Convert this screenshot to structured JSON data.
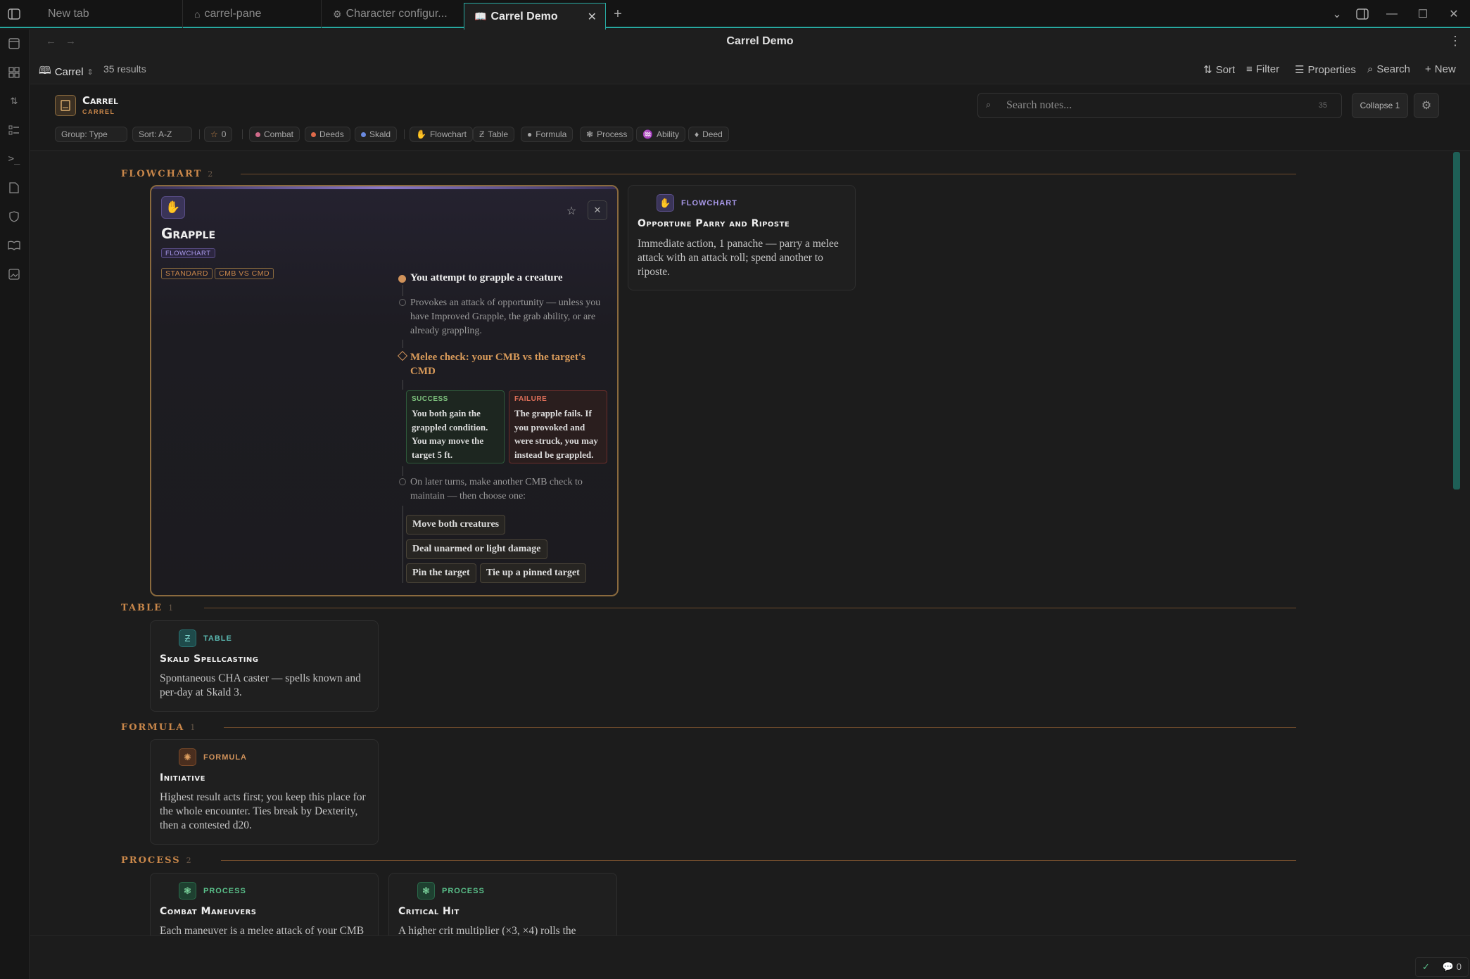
{
  "tabs": [
    {
      "label": "New tab"
    },
    {
      "label": "carrel-pane"
    },
    {
      "label": "Character configur..."
    },
    {
      "label": "Carrel Demo"
    }
  ],
  "header": {
    "title": "Carrel Demo"
  },
  "viewbar": {
    "view_name": "Carrel",
    "results": "35 results",
    "sort": "Sort",
    "filter": "Filter",
    "properties": "Properties",
    "search": "Search",
    "new": "New"
  },
  "carrel": {
    "title": "Carrel",
    "subtitle": "CARREL",
    "search_placeholder": "Search notes...",
    "search_count": "35",
    "collapse": "Collapse 1",
    "chips": [
      {
        "label": "Group: Type"
      },
      {
        "label": "Sort: A-Z"
      },
      {
        "label": "0"
      },
      {
        "label": "Combat",
        "color": "#d06a8a"
      },
      {
        "label": "Deeds",
        "color": "#e06a4a"
      },
      {
        "label": "Skald",
        "color": "#6a8ae0"
      },
      {
        "label": "Flowchart"
      },
      {
        "label": "Table"
      },
      {
        "label": "Formula"
      },
      {
        "label": "Process"
      },
      {
        "label": "Ability"
      },
      {
        "label": "Deed"
      }
    ]
  },
  "sections": {
    "flowchart": {
      "label": "FLOWCHART",
      "count": "2"
    },
    "table": {
      "label": "TABLE",
      "count": "1"
    },
    "formula": {
      "label": "FORMULA",
      "count": "1"
    },
    "process": {
      "label": "PROCESS",
      "count": "2"
    }
  },
  "grapple": {
    "title": "Grapple",
    "kind": "FLOWCHART",
    "tags": [
      "STANDARD",
      "CMB VS CMD"
    ],
    "step1": "You attempt to grapple a creature",
    "step2": "Provokes an attack of opportunity — unless you have Improved Grapple, the grab ability, or are already grappling.",
    "step3": "Melee check: your CMB vs the target's CMD",
    "success_label": "SUCCESS",
    "success_text": "You both gain the grappled condition. You may move the target 5 ft.",
    "failure_label": "FAILURE",
    "failure_text": "The grapple fails. If you provoked and were struck, you may instead be grappled.",
    "step4": "On later turns, make another CMB check to maintain — then choose one:",
    "options": [
      "Move both creatures",
      "Deal unarmed or light damage",
      "Pin the target",
      "Tie up a pinned target"
    ]
  },
  "cards": {
    "parry": {
      "kind": "FLOWCHART",
      "title": "Opportune Parry and Riposte",
      "desc": "Immediate action, 1 panache — parry a melee attack with an attack roll; spend another to riposte."
    },
    "skald": {
      "kind": "TABLE",
      "title": "Skald Spellcasting",
      "desc": "Spontaneous CHA caster — spells known and per-day at Skald 3."
    },
    "initiative": {
      "kind": "FORMULA",
      "title": "Initiative",
      "desc": "Highest result acts first; you keep this place for the whole encounter. Ties break by Dexterity, then a contested d20."
    },
    "maneuvers": {
      "kind": "PROCESS",
      "title": "Combat Maneuvers",
      "desc": "Each maneuver is a melee attack of your CMB"
    },
    "crit": {
      "kind": "PROCESS",
      "title": "Critical Hit",
      "desc": "A higher crit multiplier (×3, ×4) rolls the"
    }
  },
  "statusbar": {
    "comments": "0"
  },
  "colors": {
    "accent": "#27a8a0",
    "gold": "#c9874a",
    "purple": "#8a78c8",
    "success": "#7ec27e",
    "failure": "#e0705a"
  }
}
